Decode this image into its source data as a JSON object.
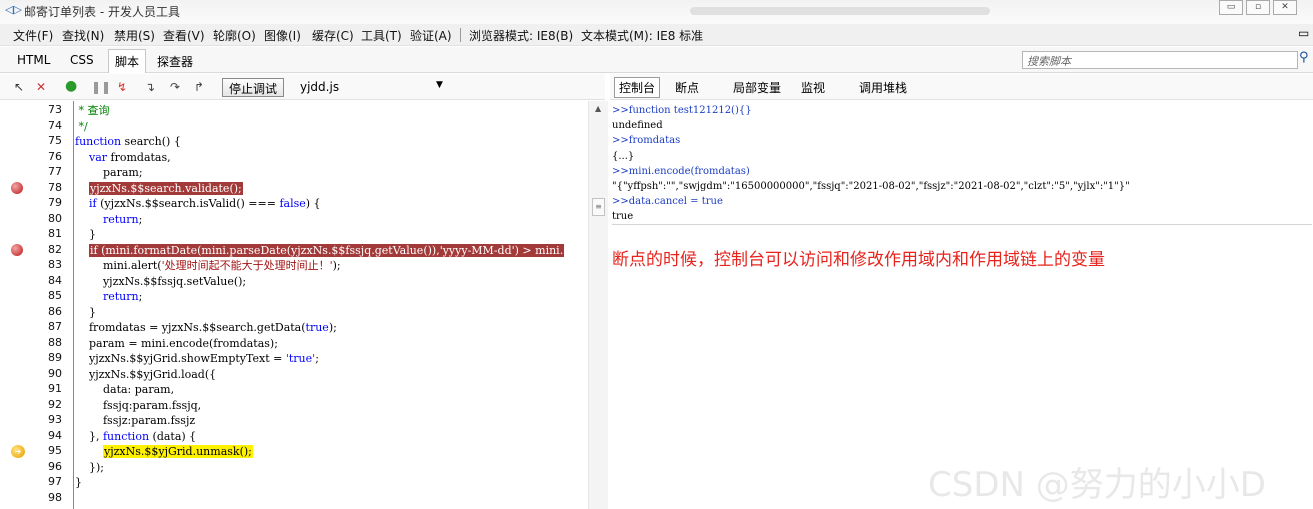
{
  "window": {
    "title": "邮寄订单列表 - 开发人员工具",
    "icon": "ie-devtools-icon",
    "controls": [
      "▭",
      "▫",
      "✕"
    ]
  },
  "menu": {
    "items": [
      "文件(F)",
      "查找(N)",
      "禁用(S)",
      "查看(V)",
      "轮廓(O)",
      "图像(I)",
      "缓存(C)",
      "工具(T)",
      "验证(A)",
      "浏览器模式: IE8(B)",
      "文本模式(M): IE8 标准"
    ],
    "pin_icon": "▭"
  },
  "tabs": {
    "items": [
      "HTML",
      "CSS",
      "脚本",
      "探查器"
    ],
    "active": "脚本"
  },
  "script_search": {
    "placeholder": "搜索脚本",
    "icon": "search-icon"
  },
  "toolbar": {
    "stop_debug_label": "停止调试",
    "file": "yjdd.js",
    "file_dropdown": "▼"
  },
  "console_tabs": {
    "items": [
      "控制台",
      "断点",
      "局部变量",
      "监视",
      "调用堆栈"
    ],
    "active": "控制台"
  },
  "code": {
    "lines": [
      {
        "n": "73",
        "t": " * 查询",
        "cls": "cm"
      },
      {
        "n": "74",
        "t": " */",
        "cls": "cm"
      },
      {
        "n": "75",
        "t": "function search() {"
      },
      {
        "n": "76",
        "t": "    var fromdatas,"
      },
      {
        "n": "77",
        "t": "        param;"
      },
      {
        "n": "78",
        "t": "    yjzxNs.$$search.validate();",
        "hl": "red",
        "bp": true
      },
      {
        "n": "79",
        "t": "    if (yjzxNs.$$search.isValid() === false) {"
      },
      {
        "n": "80",
        "t": "        return;"
      },
      {
        "n": "81",
        "t": "    }"
      },
      {
        "n": "82",
        "t": "    if (mini.formatDate(mini.parseDate(yjzxNs.$$fssjq.getValue()),'yyyy-MM-dd') > mini.",
        "hl": "red",
        "bp": true
      },
      {
        "n": "83",
        "t": "        mini.alert('处理时间起不能大于处理时间止！');"
      },
      {
        "n": "84",
        "t": "        yjzxNs.$$fssjq.setValue();"
      },
      {
        "n": "85",
        "t": "        return;"
      },
      {
        "n": "86",
        "t": "    }"
      },
      {
        "n": "87",
        "t": "    fromdatas = yjzxNs.$$search.getData(true);"
      },
      {
        "n": "88",
        "t": "    param = mini.encode(fromdatas);"
      },
      {
        "n": "89",
        "t": "    yjzxNs.$$yjGrid.showEmptyText = 'true';"
      },
      {
        "n": "90",
        "t": "    yjzxNs.$$yjGrid.load({"
      },
      {
        "n": "91",
        "t": "        data: param,"
      },
      {
        "n": "92",
        "t": "        fssjq:param.fssjq,"
      },
      {
        "n": "93",
        "t": "        fssjz:param.fssjz"
      },
      {
        "n": "94",
        "t": "    }, function (data) {"
      },
      {
        "n": "95",
        "t": "        yjzxNs.$$yjGrid.unmask();",
        "hl": "yellow",
        "current": true
      },
      {
        "n": "96",
        "t": "    });"
      },
      {
        "n": "97",
        "t": "}"
      },
      {
        "n": "98",
        "t": ""
      }
    ]
  },
  "console": {
    "lines": [
      {
        "t": ">>function test121212(){}",
        "type": "in"
      },
      {
        "t": "undefined",
        "type": "out"
      },
      {
        "t": ">>fromdatas",
        "type": "in"
      },
      {
        "t": "{...}",
        "type": "out"
      },
      {
        "t": ">>mini.encode(fromdatas)",
        "type": "in"
      },
      {
        "t": "\"{\"yffpsh\":\"\",\"swjgdm\":\"16500000000\",\"fssjq\":\"2021-08-02\",\"fssjz\":\"2021-08-02\",\"clzt\":\"5\",\"yjlx\":\"1\"}\"",
        "type": "out"
      },
      {
        "t": ">>data.cancel = true",
        "type": "in"
      },
      {
        "t": "true",
        "type": "out"
      }
    ]
  },
  "annotation": "断点的时候，控制台可以访问和修改作用域内和作用域链上的变量",
  "watermark": "CSDN @努力的小小D",
  "colors": {
    "breakpoint_line": "#a33a3a",
    "current_line": "#fff200",
    "annotation": "#e8231c",
    "console_input": "#1a3cc4"
  }
}
